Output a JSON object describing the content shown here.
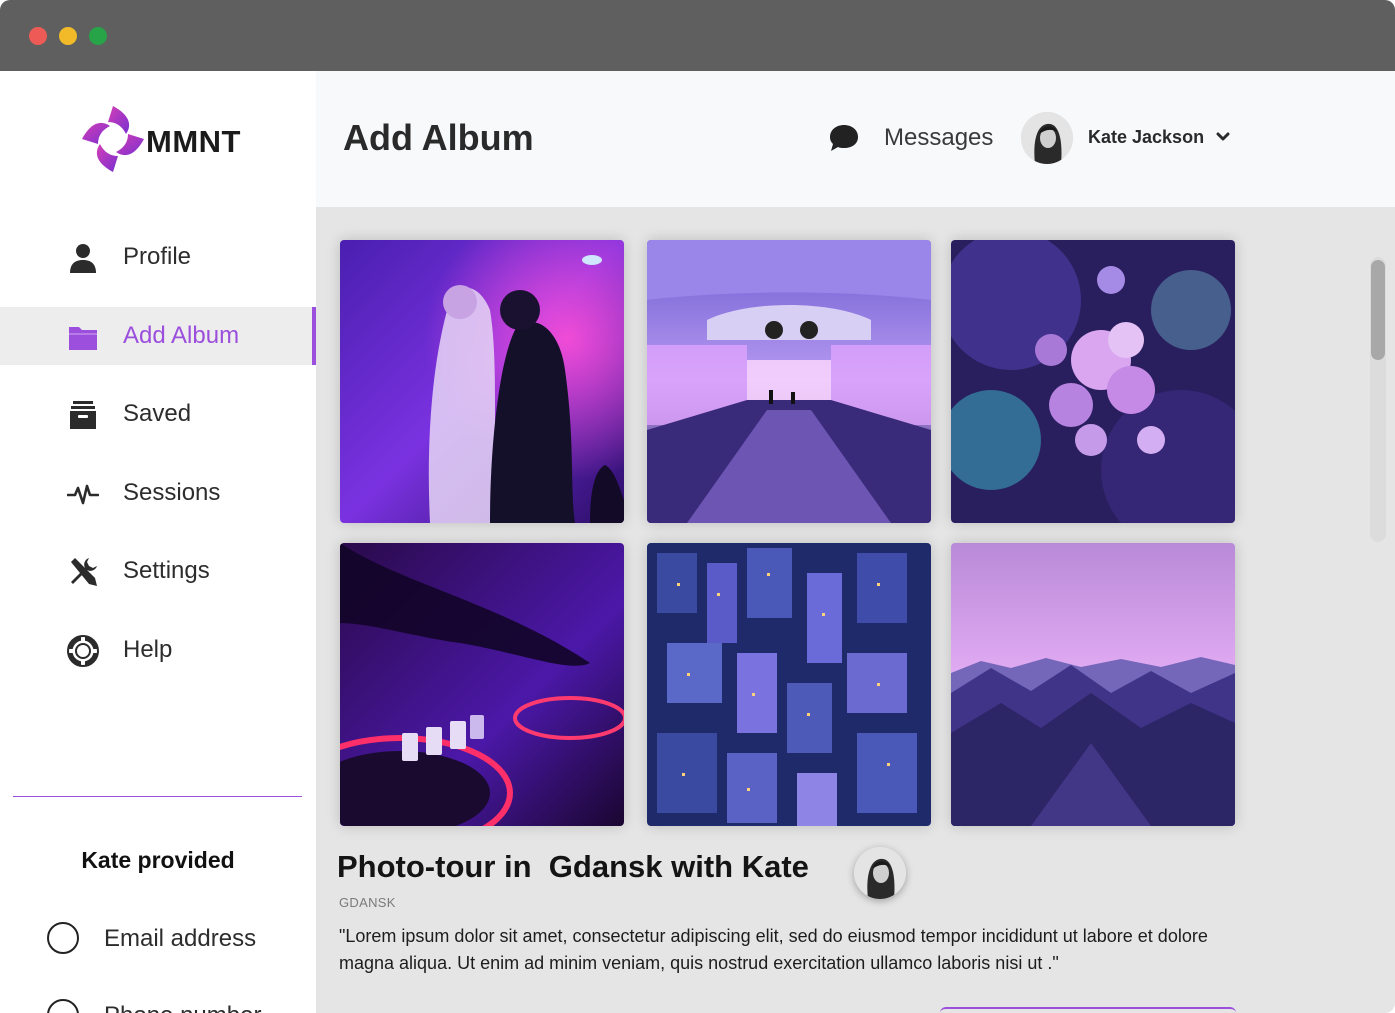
{
  "app": {
    "brand": "MMNT",
    "brand_color": "#9b4fdc"
  },
  "sidebar": {
    "items": [
      {
        "label": "Profile",
        "icon": "user-icon",
        "active": false
      },
      {
        "label": "Add Album",
        "icon": "folder-icon",
        "active": true
      },
      {
        "label": "Saved",
        "icon": "archive-box-icon",
        "active": false
      },
      {
        "label": "Sessions",
        "icon": "activity-pulse-icon",
        "active": false
      },
      {
        "label": "Settings",
        "icon": "tools-icon",
        "active": false
      },
      {
        "label": "Help",
        "icon": "lifebuoy-icon",
        "active": false
      }
    ],
    "provided": {
      "title": "Kate provided",
      "options": [
        {
          "label": "Email address"
        },
        {
          "label": "Phone number"
        }
      ]
    }
  },
  "header": {
    "title": "Add Album",
    "messages_label": "Messages",
    "user_name": "Kate Jackson"
  },
  "gallery": {
    "photos": [
      {
        "subject": "couple dancing under purple light"
      },
      {
        "subject": "purple lit corridor"
      },
      {
        "subject": "purple abstract flowers"
      },
      {
        "subject": "dj mixer in purple light"
      },
      {
        "subject": "city skyline at night from above"
      },
      {
        "subject": "mountains under purple sky"
      }
    ]
  },
  "album": {
    "title": "Photo-tour in  Gdansk with Kate",
    "location": "GDANSK",
    "description": "\"Lorem ipsum dolor sit amet, consectetur adipiscing elit, sed do eiusmod tempor incididunt ut labore et dolore magna aliqua. Ut enim ad minim veniam, quis nostrud exercitation ullamco laboris nisi ut .\""
  }
}
